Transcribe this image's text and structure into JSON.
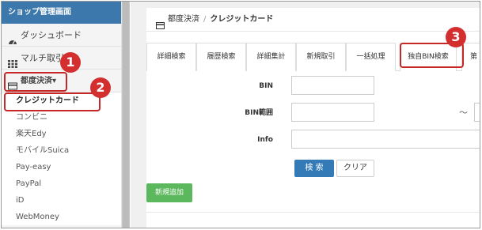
{
  "sidebar": {
    "header": "ショップ管理画面",
    "items": [
      {
        "label": "ダッシュボード",
        "icon": "dashboard-icon"
      },
      {
        "label": "マルチ取引",
        "icon": "grid-icon"
      },
      {
        "label": "都度決済▾",
        "icon": "card-icon"
      }
    ],
    "submenu": [
      "クレジットカード",
      "コンビニ",
      "楽天Edy",
      "モバイルSuica",
      "Pay-easy",
      "PayPal",
      "iD",
      "WebMoney"
    ]
  },
  "breadcrumb": {
    "section": "都度決済",
    "separator": "/",
    "page": "クレジットカード"
  },
  "tabs": [
    "詳細検索",
    "履歴検索",
    "詳細集計",
    "新規取引",
    "一括処理",
    "独自BIN検索",
    "第"
  ],
  "form": {
    "bin_label": "BIN",
    "bin_range_label": "BIN範囲",
    "range_separator": "～",
    "info_label": "Info"
  },
  "buttons": {
    "search": "検 索",
    "clear": "クリア",
    "new": "新規追加"
  },
  "callouts": [
    "1",
    "2",
    "3"
  ],
  "colors": {
    "header": "#3d78ad",
    "primary": "#337ab7",
    "success": "#5cb85c",
    "callout": "#d32f2f"
  }
}
